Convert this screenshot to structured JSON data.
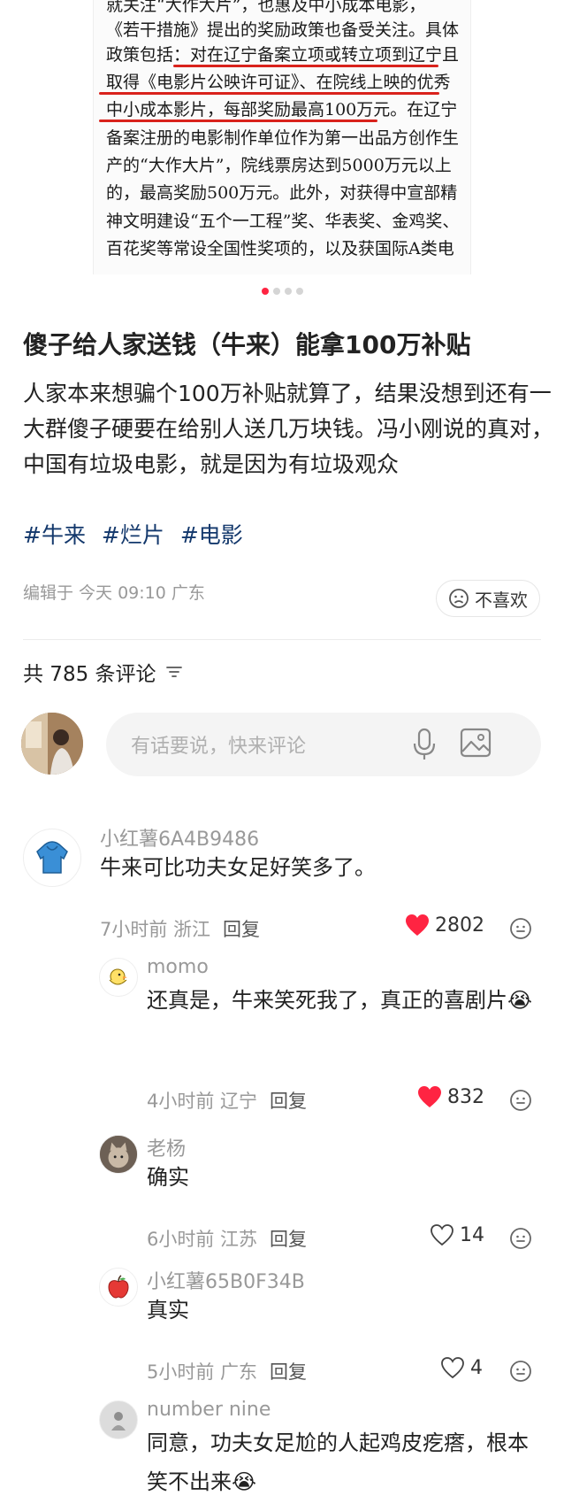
{
  "article_image": {
    "lines": [
      "就关注“大作大片”，也惠及中小成本电影，",
      "《若干措施》提出的奖励政策也备受关注。具体",
      "政策包括：对在辽宁备案立项或转立项到辽宁且",
      "取得《电影片公映许可证》、在院线上映的优秀",
      "中小成本影片，每部奖励最高100万元。在辽宁",
      "备案注册的电影制作单位作为第一出品方创作生",
      "产的“大作大片”，院线票房达到5000万元以上",
      "的，最高奖励500万元。此外，对获得中宣部精",
      "神文明建设“五个一工程”奖、华表奖、金鸡奖、",
      "百花奖等常设全国性奖项的，以及获国际A类电"
    ]
  },
  "carousel": {
    "total": 4,
    "active": 1
  },
  "post": {
    "title": "傻子给人家送钱（牛来）能拿100万补贴",
    "body": "人家本来想骗个100万补贴就算了，结果没想到还有一大群傻子硬要在给别人送几万块钱。冯小刚说的真对，中国有垃圾电影，就是因为有垃圾观众",
    "tags": [
      "#牛来",
      "#烂片",
      "#电影"
    ],
    "meta": "编辑于 今天 09:10 广东",
    "dislike_label": "不喜欢"
  },
  "comments_header": {
    "label": "共 785 条评论"
  },
  "composer": {
    "placeholder": "有话要说，快来评论"
  },
  "comments": [
    {
      "name": "小红薯6A4B9486",
      "text": "牛来可比功夫女足好笑多了。",
      "time": "7小时前 浙江",
      "reply": "回复",
      "likes": "2802",
      "liked": true
    },
    {
      "name": "momo",
      "text": "还真是，牛来笑死我了，真正的喜剧片😭",
      "time": "4小时前 辽宁",
      "reply": "回复",
      "likes": "832",
      "liked": true
    },
    {
      "name": "老杨",
      "text": "确实",
      "time": "6小时前 江苏",
      "reply": "回复",
      "likes": "14",
      "liked": false
    },
    {
      "name": "小红薯65B0F34B",
      "text": "真实",
      "time": "5小时前 广东",
      "reply": "回复",
      "likes": "4",
      "liked": false
    },
    {
      "name": "number nine",
      "text": "同意，功夫女足尬的人起鸡皮疙瘩，根本笑不出来😭",
      "time": "",
      "reply": "",
      "likes": "",
      "liked": false
    }
  ],
  "colors": {
    "accent": "#ff2442",
    "tag": "#13386c",
    "underline": "#d9221c"
  }
}
